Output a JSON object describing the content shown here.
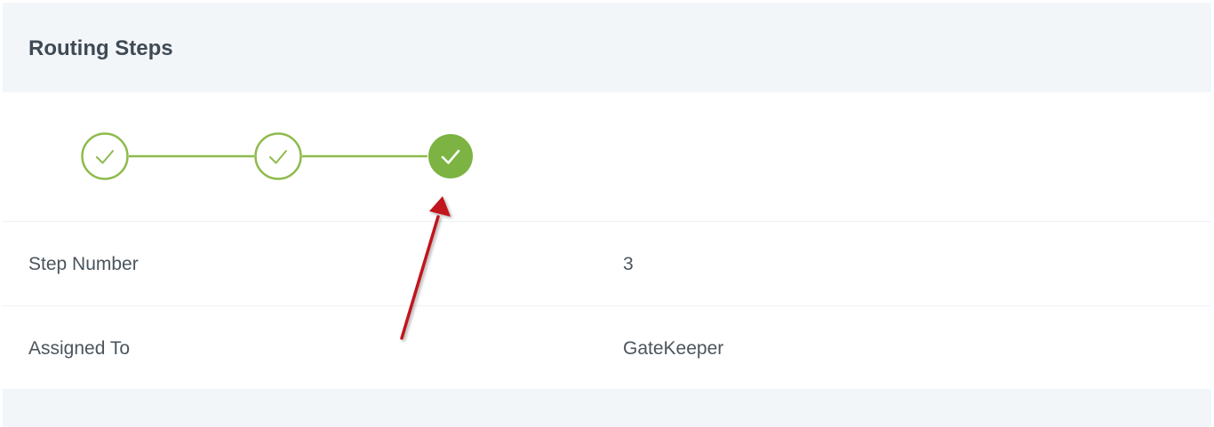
{
  "panel": {
    "title": "Routing Steps"
  },
  "stepper": {
    "steps": [
      {
        "status": "completed",
        "icon": "check-icon"
      },
      {
        "status": "completed",
        "icon": "check-icon"
      },
      {
        "status": "current",
        "icon": "check-icon"
      }
    ],
    "colors": {
      "accent": "#8dbb4b",
      "current_fill": "#7cb342"
    }
  },
  "details": {
    "rows": [
      {
        "label": "Step Number",
        "value": "3"
      },
      {
        "label": "Assigned To",
        "value": "GateKeeper"
      }
    ]
  },
  "annotation": {
    "type": "arrow",
    "color": "#c0121b",
    "points_to": "step-3"
  }
}
